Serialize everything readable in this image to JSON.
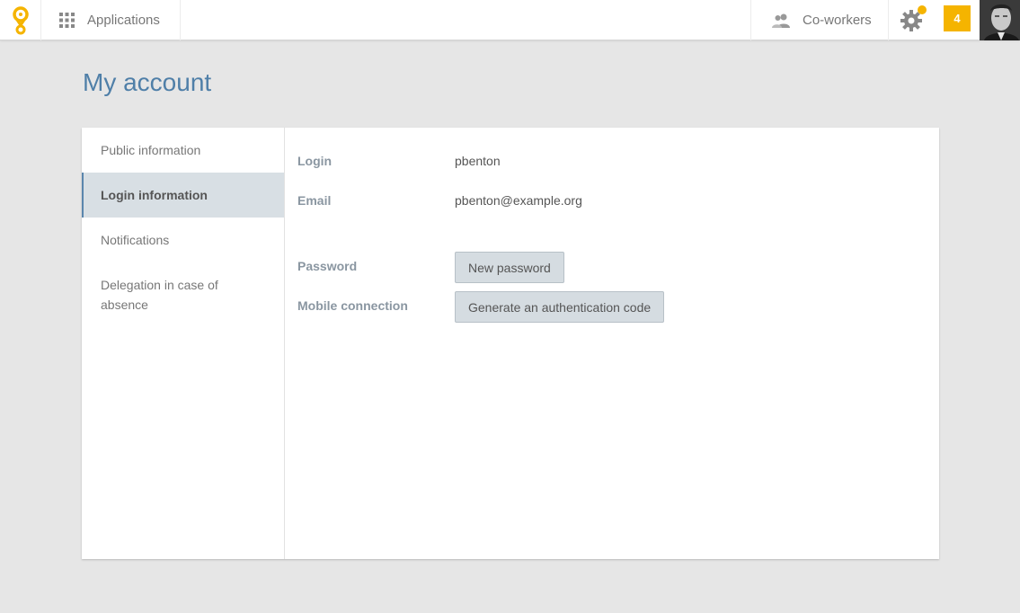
{
  "topbar": {
    "applications_label": "Applications",
    "coworkers_label": "Co-workers",
    "notification_count": "4",
    "accent_color": "#f5b400"
  },
  "page": {
    "title": "My account"
  },
  "sidebar": {
    "items": [
      {
        "label": "Public information",
        "active": false
      },
      {
        "label": "Login information",
        "active": true
      },
      {
        "label": "Notifications",
        "active": false
      },
      {
        "label": "Delegation in case of absence",
        "active": false
      }
    ]
  },
  "login": {
    "login_label": "Login",
    "login_value": "pbenton",
    "email_label": "Email",
    "email_value": "pbenton@example.org",
    "password_label": "Password",
    "password_button": "New password",
    "mobile_label": "Mobile connection",
    "mobile_button": "Generate an authentication code"
  },
  "icons": [
    "logo-icon",
    "apps-grid-icon",
    "coworkers-icon",
    "gear-icon",
    "avatar"
  ]
}
